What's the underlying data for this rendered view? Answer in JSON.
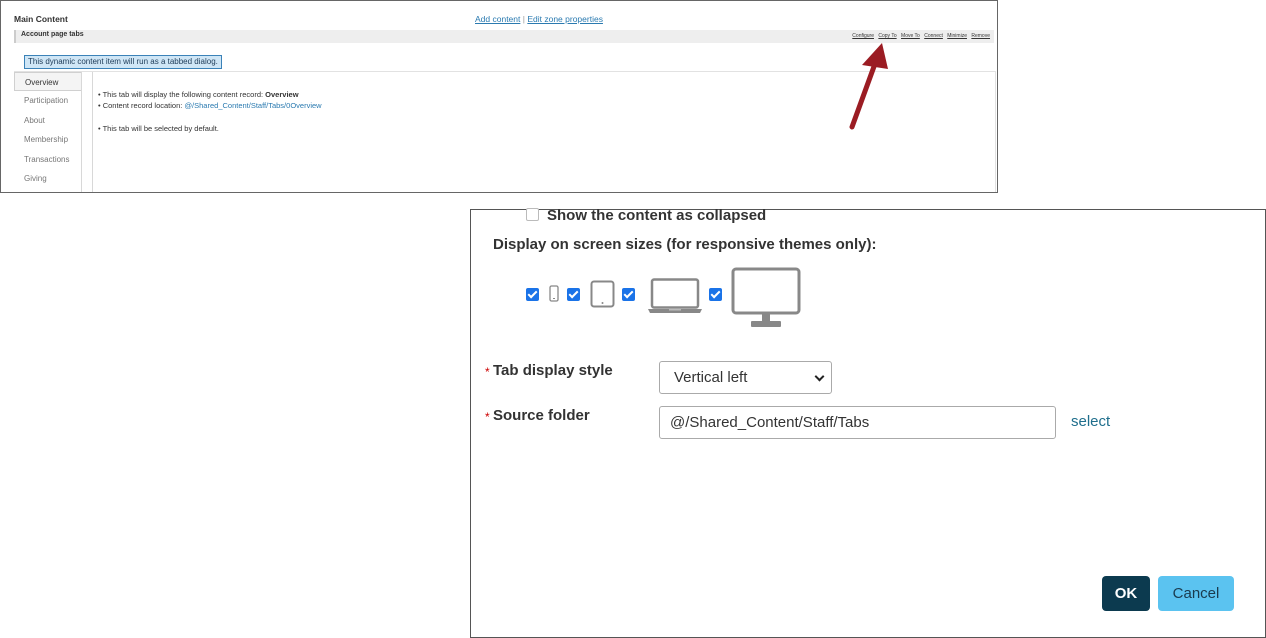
{
  "top": {
    "zone_title": "Main Content",
    "add_content": "Add content",
    "separator": "|",
    "edit_zone": "Edit zone properties",
    "item_title": "Account page tabs",
    "actions": [
      "Configure",
      "Copy To",
      "Move To",
      "Connect",
      "Minimize",
      "Remove"
    ],
    "info": "This dynamic content item will run as a tabbed dialog.",
    "tabs": [
      "Overview",
      "Participation",
      "About",
      "Membership",
      "Transactions",
      "Giving"
    ],
    "content": {
      "line1_prefix": "• This tab will display the following content record:",
      "line1_bold": "Overview",
      "line2_prefix": "• Content record location:",
      "line2_path": "@/Shared_Content/Staff/Tabs/0Overview",
      "line3": "• This tab will be selected by default."
    },
    "arrow_color": "#9b1c23"
  },
  "dialog": {
    "collapsed_label": "Show the content as collapsed",
    "collapsed_checked": false,
    "screens_heading": "Display on screen sizes (for responsive themes only):",
    "devices": [
      {
        "icon": "phone-icon",
        "checked": true
      },
      {
        "icon": "tablet-icon",
        "checked": true
      },
      {
        "icon": "laptop-icon",
        "checked": true
      },
      {
        "icon": "desktop-icon",
        "checked": true
      }
    ],
    "required_mark": "*",
    "tab_style_label": "Tab display style",
    "tab_style_value": "Vertical left",
    "source_folder_label": "Source folder",
    "source_folder_value": "@/Shared_Content/Staff/Tabs",
    "select_link": "select",
    "ok": "OK",
    "cancel": "Cancel",
    "colors": {
      "ok_bg": "#0c3a4f",
      "cancel_bg": "#5bc3f0",
      "checkbox": "#1a73e8",
      "required": "#cc0000"
    }
  }
}
